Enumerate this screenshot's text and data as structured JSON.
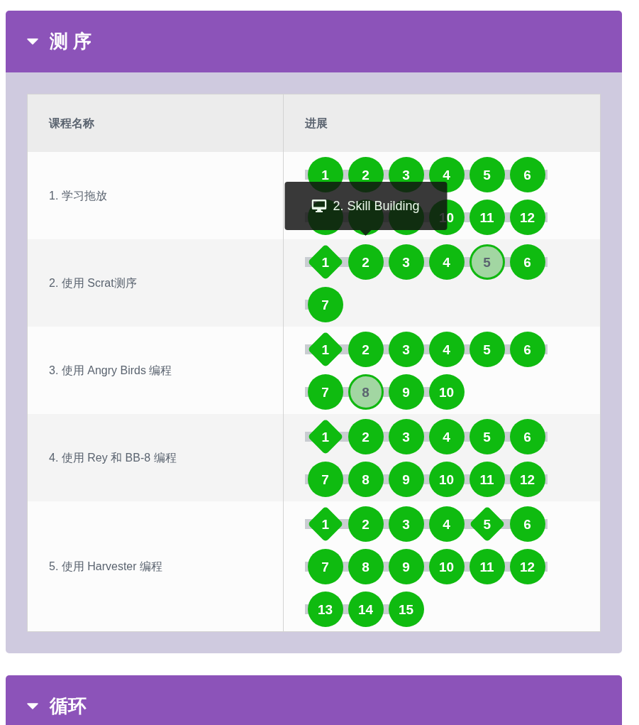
{
  "sections": [
    {
      "title": "测 序",
      "expanded": true,
      "table": {
        "columns": [
          "课程名称",
          "进展"
        ],
        "rows": [
          {
            "lesson": "1. 学习拖放",
            "levels": [
              {
                "label": "1",
                "kind": "circle",
                "completed": true
              },
              {
                "label": "2",
                "kind": "circle",
                "completed": true
              },
              {
                "label": "3",
                "kind": "circle",
                "completed": true
              },
              {
                "label": "4",
                "kind": "circle",
                "completed": true
              },
              {
                "label": "5",
                "kind": "circle",
                "completed": true
              },
              {
                "label": "6",
                "kind": "circle",
                "completed": true
              },
              {
                "kind": "covered"
              },
              {
                "kind": "covered"
              },
              {
                "kind": "covered"
              },
              {
                "label": "10",
                "kind": "circle",
                "completed": true
              },
              {
                "label": "11",
                "kind": "circle",
                "completed": true
              },
              {
                "label": "12",
                "kind": "circle",
                "completed": true
              }
            ]
          },
          {
            "lesson": "2. 使用 Scrat测序",
            "levels": [
              {
                "label": "1",
                "kind": "diamond",
                "completed": true
              },
              {
                "label": "2",
                "kind": "circle",
                "completed": true,
                "tooltip": {
                  "text": "2. Skill Building"
                }
              },
              {
                "label": "3",
                "kind": "circle",
                "completed": true
              },
              {
                "label": "4",
                "kind": "circle",
                "completed": true
              },
              {
                "label": "5",
                "kind": "circle",
                "completed": false
              },
              {
                "label": "6",
                "kind": "circle",
                "completed": true
              },
              {
                "label": "7",
                "kind": "circle",
                "completed": true
              }
            ]
          },
          {
            "lesson": "3. 使用 Angry Birds 编程",
            "levels": [
              {
                "label": "1",
                "kind": "diamond",
                "completed": true
              },
              {
                "label": "2",
                "kind": "circle",
                "completed": true
              },
              {
                "label": "3",
                "kind": "circle",
                "completed": true
              },
              {
                "label": "4",
                "kind": "circle",
                "completed": true
              },
              {
                "label": "5",
                "kind": "circle",
                "completed": true
              },
              {
                "label": "6",
                "kind": "circle",
                "completed": true
              },
              {
                "label": "7",
                "kind": "circle",
                "completed": true
              },
              {
                "label": "8",
                "kind": "circle",
                "completed": false
              },
              {
                "label": "9",
                "kind": "circle",
                "completed": true
              },
              {
                "label": "10",
                "kind": "circle",
                "completed": true
              }
            ]
          },
          {
            "lesson": "4. 使用 Rey 和 BB-8 编程",
            "levels": [
              {
                "label": "1",
                "kind": "diamond",
                "completed": true
              },
              {
                "label": "2",
                "kind": "circle",
                "completed": true
              },
              {
                "label": "3",
                "kind": "circle",
                "completed": true
              },
              {
                "label": "4",
                "kind": "circle",
                "completed": true
              },
              {
                "label": "5",
                "kind": "circle",
                "completed": true
              },
              {
                "label": "6",
                "kind": "circle",
                "completed": true
              },
              {
                "label": "7",
                "kind": "circle",
                "completed": true
              },
              {
                "label": "8",
                "kind": "circle",
                "completed": true
              },
              {
                "label": "9",
                "kind": "circle",
                "completed": true
              },
              {
                "label": "10",
                "kind": "circle",
                "completed": true
              },
              {
                "label": "11",
                "kind": "circle",
                "completed": true
              },
              {
                "label": "12",
                "kind": "circle",
                "completed": true
              }
            ]
          },
          {
            "lesson": "5. 使用 Harvester 编程",
            "levels": [
              {
                "label": "1",
                "kind": "diamond",
                "completed": true
              },
              {
                "label": "2",
                "kind": "circle",
                "completed": true
              },
              {
                "label": "3",
                "kind": "circle",
                "completed": true
              },
              {
                "label": "4",
                "kind": "circle",
                "completed": true
              },
              {
                "label": "5",
                "kind": "diamond",
                "completed": true
              },
              {
                "label": "6",
                "kind": "circle",
                "completed": true
              },
              {
                "label": "7",
                "kind": "circle",
                "completed": true
              },
              {
                "label": "8",
                "kind": "circle",
                "completed": true
              },
              {
                "label": "9",
                "kind": "circle",
                "completed": true
              },
              {
                "label": "10",
                "kind": "circle",
                "completed": true
              },
              {
                "label": "11",
                "kind": "circle",
                "completed": true
              },
              {
                "label": "12",
                "kind": "circle",
                "completed": true
              },
              {
                "label": "13",
                "kind": "circle",
                "completed": true
              },
              {
                "label": "14",
                "kind": "circle",
                "completed": true
              },
              {
                "label": "15",
                "kind": "circle",
                "completed": true
              }
            ]
          }
        ]
      }
    },
    {
      "title": "循环",
      "expanded": true
    }
  ]
}
